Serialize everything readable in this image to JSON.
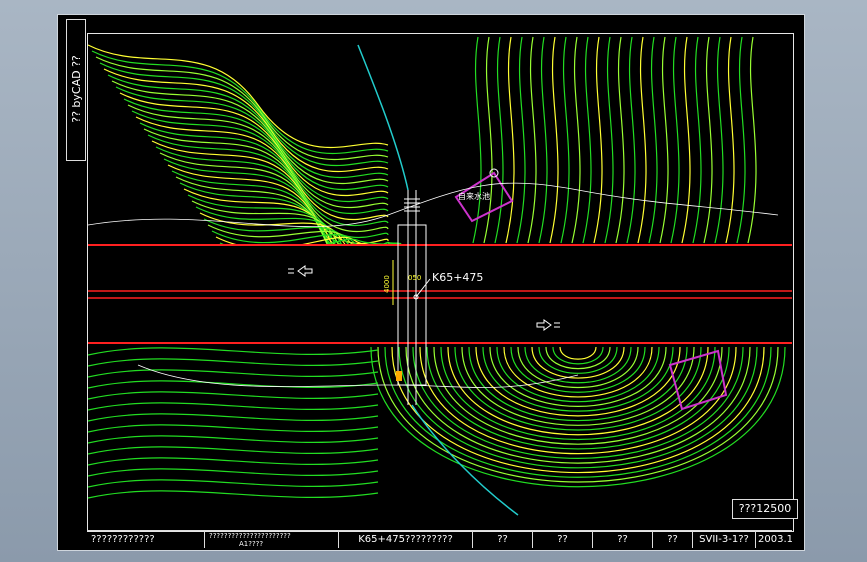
{
  "sidebar": {
    "stamp_text": "?? byCAD ??"
  },
  "map": {
    "station_label": "K65+475",
    "width_label": "4000",
    "offset_label": "050",
    "pond_label": "自来水池"
  },
  "title_block": {
    "cells": [
      "????????????",
      "K65+475?????????",
      "??",
      "??",
      "??",
      "??",
      "SVII-3-1??",
      "2003.1"
    ],
    "stack_top": "??????????????????????",
    "stack_bottom": "A1????"
  },
  "scale": {
    "label": "???12500"
  },
  "colors": {
    "background": "#000000",
    "road": "#ff2020",
    "contour_yellow": "#ffff33",
    "contour_green": "#22dd22",
    "contour_lightgreen": "#99ff33",
    "water": "#22cccc",
    "building": "#cc33cc"
  }
}
